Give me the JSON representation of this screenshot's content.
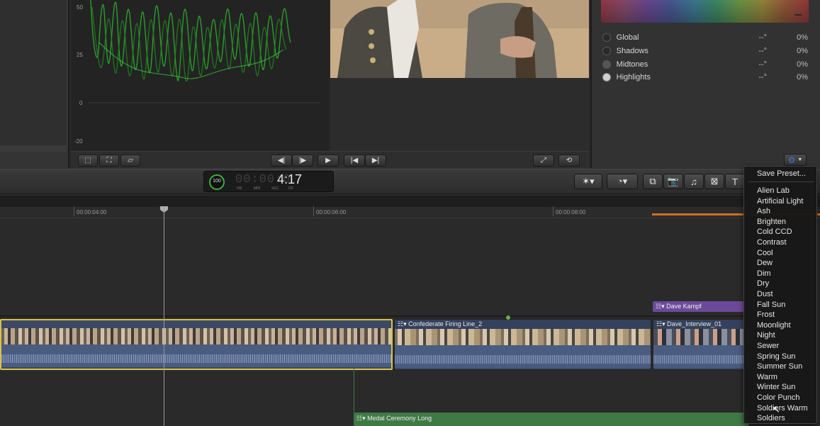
{
  "scope": {
    "labels": [
      "50",
      "25",
      "0",
      "-20"
    ]
  },
  "inspector": {
    "rows": [
      {
        "name": "Global",
        "deg": "--°",
        "pct": "0%",
        "on": false
      },
      {
        "name": "Shadows",
        "deg": "--°",
        "pct": "0%",
        "on": false
      },
      {
        "name": "Midtones",
        "deg": "--°",
        "pct": "0%",
        "on": false
      },
      {
        "name": "Highlights",
        "deg": "--°",
        "pct": "0%",
        "on": true
      }
    ]
  },
  "timecode": {
    "value": "4:17",
    "percent": "100",
    "units": [
      "HR",
      "MIN",
      "SEC",
      "FR"
    ]
  },
  "ruler": {
    "ticks": [
      "00:00:04:00",
      "00:00:06:00",
      "00:00:08:00"
    ]
  },
  "clips": {
    "c2": "Confederate Firing Line_2",
    "c3": "Dave Kampf",
    "c4": "Dave_Interview_01",
    "c5": "Medal Ceremony Long"
  },
  "menu": {
    "save": "Save Preset...",
    "items": [
      "Alien Lab",
      "Artificial Light",
      "Ash",
      "Brighten",
      "Cold CCD",
      "Contrast",
      "Cool",
      "Dew",
      "Dim",
      "Dry",
      "Dust",
      "Fall Sun",
      "Frost",
      "Moonlight",
      "Night",
      "Sewer",
      "Spring Sun",
      "Summer Sun",
      "Warm",
      "Winter Sun",
      "Color Punch",
      "Soldiers Warm",
      "Soldiers"
    ]
  },
  "colors": {
    "accent": "#3a78d8",
    "selected_clip": "#d7c24a",
    "connected_clip": "#3f7a46",
    "title_clip": "#6c4a9a"
  }
}
